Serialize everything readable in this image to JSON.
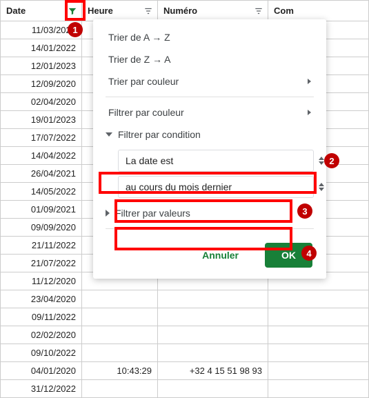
{
  "columns": {
    "date": "Date",
    "heure": "Heure",
    "numero": "Numéro",
    "com": "Com"
  },
  "rows": [
    {
      "date": "11/03/2022",
      "heure": "",
      "numero": ""
    },
    {
      "date": "14/01/2022",
      "heure": "",
      "numero": ""
    },
    {
      "date": "12/01/2023",
      "heure": "",
      "numero": ""
    },
    {
      "date": "12/09/2020",
      "heure": "",
      "numero": ""
    },
    {
      "date": "02/04/2020",
      "heure": "",
      "numero": ""
    },
    {
      "date": "19/01/2023",
      "heure": "",
      "numero": ""
    },
    {
      "date": "17/07/2022",
      "heure": "",
      "numero": ""
    },
    {
      "date": "14/04/2022",
      "heure": "",
      "numero": ""
    },
    {
      "date": "26/04/2021",
      "heure": "",
      "numero": ""
    },
    {
      "date": "14/05/2022",
      "heure": "",
      "numero": ""
    },
    {
      "date": "01/09/2021",
      "heure": "",
      "numero": ""
    },
    {
      "date": "09/09/2020",
      "heure": "",
      "numero": ""
    },
    {
      "date": "21/11/2022",
      "heure": "",
      "numero": ""
    },
    {
      "date": "21/07/2022",
      "heure": "",
      "numero": ""
    },
    {
      "date": "11/12/2020",
      "heure": "",
      "numero": ""
    },
    {
      "date": "23/04/2020",
      "heure": "",
      "numero": ""
    },
    {
      "date": "09/11/2022",
      "heure": "",
      "numero": ""
    },
    {
      "date": "02/02/2020",
      "heure": "",
      "numero": ""
    },
    {
      "date": "09/10/2022",
      "heure": "",
      "numero": ""
    },
    {
      "date": "04/01/2020",
      "heure": "10:43:29",
      "numero": "+32 4 15 51 98 93"
    },
    {
      "date": "31/12/2022",
      "heure": "",
      "numero": ""
    }
  ],
  "menu": {
    "sort_az": "Trier de A → Z",
    "sort_za": "Trier de Z → A",
    "sort_color": "Trier par couleur",
    "filter_color": "Filtrer par couleur",
    "filter_condition": "Filtrer par condition",
    "condition_select": "La date est",
    "condition_value": "au cours du mois dernier",
    "filter_values": "Filtrer par valeurs",
    "cancel": "Annuler",
    "ok": "OK"
  },
  "callouts": {
    "c1": "1",
    "c2": "2",
    "c3": "3",
    "c4": "4"
  }
}
